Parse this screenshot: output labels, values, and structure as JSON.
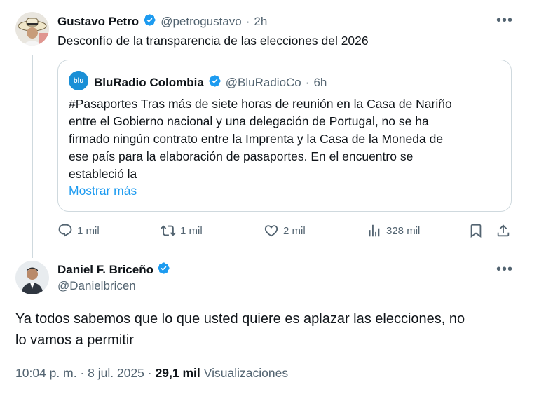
{
  "original_tweet": {
    "author_name": "Gustavo Petro",
    "handle": "@petrogustavo",
    "separator": "·",
    "time": "2h",
    "text": "Desconfío de la transparencia de las elecciones del 2026"
  },
  "quoted_tweet": {
    "avatar_text": "blu",
    "author_name": "BluRadio Colombia",
    "handle": "@BluRadioCo",
    "separator": "·",
    "time": "6h",
    "text_lines": [
      "#Pasaportes Tras más de siete horas de reunión en la Casa de Nariño",
      "entre el Gobierno nacional y una delegación de Portugal, no se ha",
      "firmado ningún contrato entre la Imprenta y la Casa de la Moneda de",
      "ese país para la elaboración de pasaportes. En el encuentro se",
      "estableció la"
    ],
    "show_more": "Mostrar más"
  },
  "actions": {
    "replies": "1 mil",
    "reposts": "1 mil",
    "likes": "2 mil",
    "views": "328 mil"
  },
  "reply_tweet": {
    "author_name": "Daniel F. Briceño",
    "handle": "@Danielbricen",
    "text_lines": [
      "Ya todos sabemos que lo que usted quiere es aplazar las elecciones, no",
      "lo vamos a permitir"
    ],
    "timestamp": "10:04 p. m. · 8 jul. 2025 ·",
    "views_count": "29,1 mil",
    "views_label": "Visualizaciones"
  },
  "more_menu": "•••",
  "colors": {
    "accent": "#1d9bf0",
    "muted": "#536471",
    "text": "#0f1419",
    "border": "#cfd9de",
    "blu_brand": "#1a8fd6"
  },
  "icons": [
    "verified-badge-icon",
    "reply-icon",
    "repost-icon",
    "like-icon",
    "views-icon",
    "bookmark-icon",
    "share-icon",
    "more-icon"
  ]
}
